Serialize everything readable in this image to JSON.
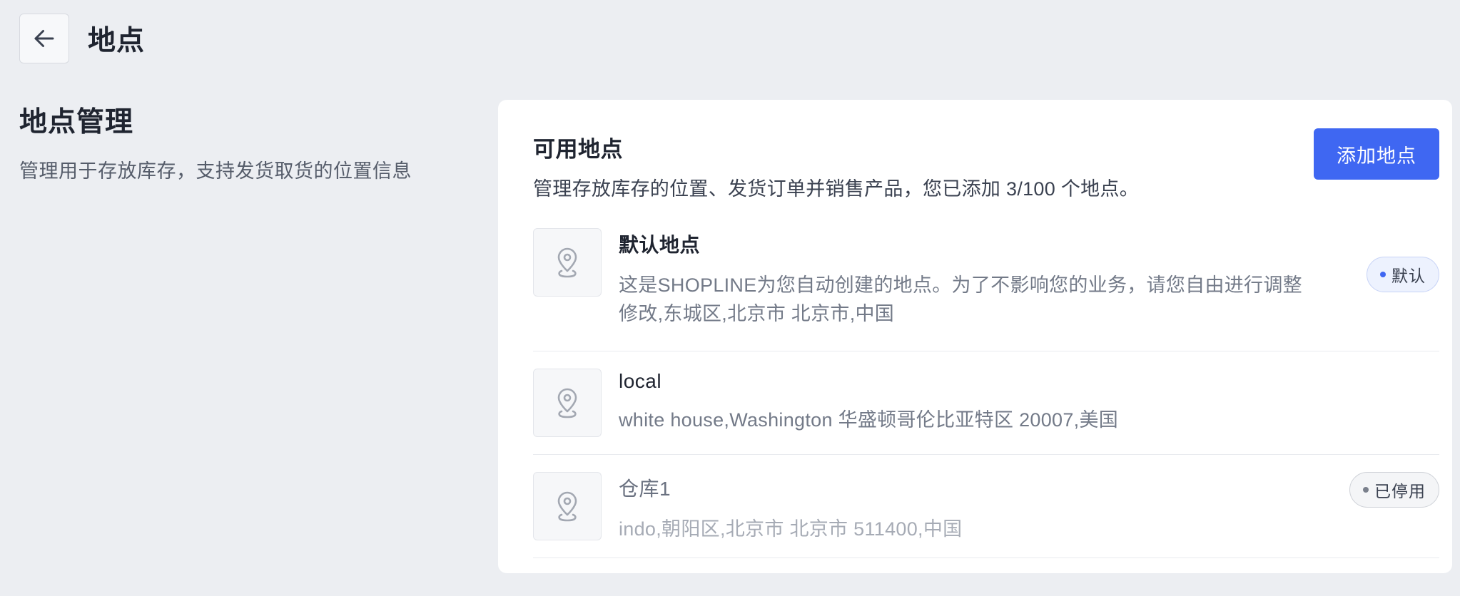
{
  "header": {
    "title": "地点"
  },
  "left": {
    "title": "地点管理",
    "description": "管理用于存放库存，支持发货取货的位置信息"
  },
  "card": {
    "title": "可用地点",
    "description": "管理存放库存的位置、发货订单并销售产品，您已添加 3/100 个地点。",
    "add_button_label": "添加地点"
  },
  "locations": [
    {
      "name": "默认地点",
      "address_line1": "这是SHOPLINE为您自动创建的地点。为了不影响您的业务，请您自由进行调整",
      "address_line2": "修改,东城区,北京市 北京市,中国",
      "badge": "默认",
      "badge_dot_color": "#3f67f2"
    },
    {
      "name": "local",
      "address_line1": "white house,Washington 华盛顿哥伦比亚特区 20007,美国"
    },
    {
      "name": "仓库1",
      "address_line1": "indo,朝阳区,北京市 北京市 511400,中国",
      "badge": "已停用",
      "badge_dot_color": "#7a808c"
    }
  ],
  "icons": {
    "back": "arrow-left-icon",
    "location": "map-pin-icon"
  },
  "colors": {
    "background": "#eceef2",
    "primary": "#3f67f2",
    "card": "#ffffff"
  }
}
